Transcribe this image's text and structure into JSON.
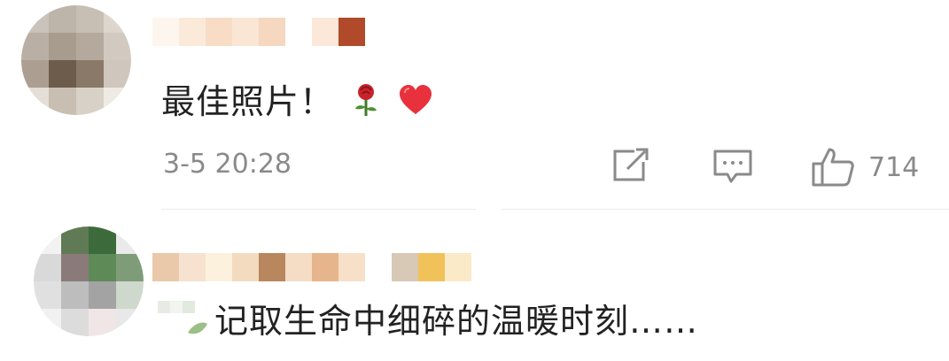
{
  "comments": [
    {
      "username": "",
      "text": "最佳照片！",
      "emojis": [
        "rose-emoji",
        "heart-emoji"
      ],
      "timestamp": "3-5 20:28",
      "actions": {
        "share_icon": "share-icon",
        "reply_icon": "reply-icon",
        "like_icon": "thumbs-up-icon",
        "like_count": "714"
      }
    },
    {
      "username": "",
      "text": "记取生命中细碎的温暖时刻……"
    }
  ],
  "colors": {
    "text": "#222222",
    "meta": "#8a8a8a",
    "divider": "#ececec"
  }
}
